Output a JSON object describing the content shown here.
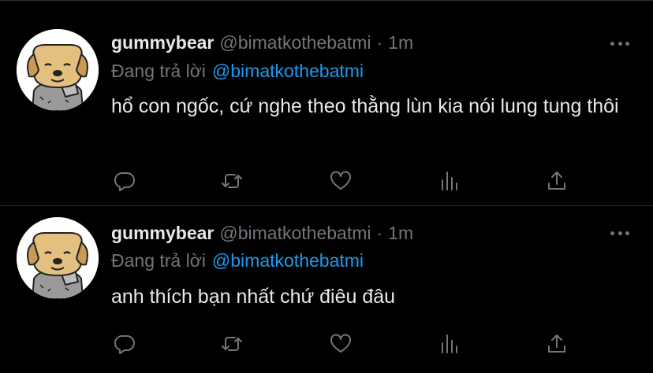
{
  "tweets": [
    {
      "name": "gummybear",
      "handle": "@bimatkothebatmi",
      "separator": "·",
      "time": "1m",
      "replying_prefix": "Đang trả lời",
      "replying_to": "@bimatkothebatmi",
      "text": "hổ con ngốc, cứ nghe theo thằng lùn kia nói lung tung thôi"
    },
    {
      "name": "gummybear",
      "handle": "@bimatkothebatmi",
      "separator": "·",
      "time": "1m",
      "replying_prefix": "Đang trả lời",
      "replying_to": "@bimatkothebatmi",
      "text": "anh thích bạn nhất chứ điêu đâu"
    }
  ],
  "icons": {
    "reply": "reply-icon",
    "retweet": "retweet-icon",
    "like": "heart-icon",
    "views": "views-icon",
    "share": "share-icon",
    "more": "more-icon"
  },
  "colors": {
    "background": "#000000",
    "text": "#e7e9ea",
    "secondary": "#71767b",
    "accent": "#1d9bf0",
    "divider": "#2f3336"
  }
}
